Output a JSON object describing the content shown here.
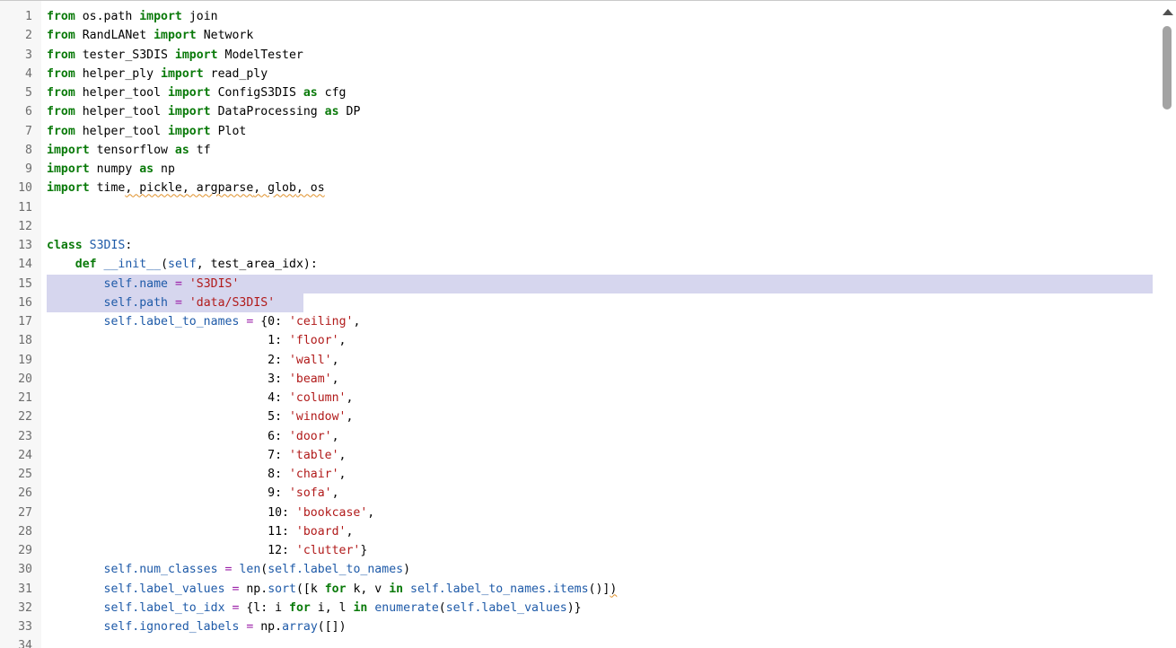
{
  "editor": {
    "highlighted_lines": [
      15,
      16
    ],
    "lines": [
      {
        "n": "1",
        "segs": [
          {
            "t": "from",
            "c": "kw"
          },
          {
            "t": " os.path "
          },
          {
            "t": "import",
            "c": "kw"
          },
          {
            "t": " join"
          }
        ]
      },
      {
        "n": "2",
        "segs": [
          {
            "t": "from",
            "c": "kw"
          },
          {
            "t": " RandLANet "
          },
          {
            "t": "import",
            "c": "kw"
          },
          {
            "t": " Network"
          }
        ]
      },
      {
        "n": "3",
        "segs": [
          {
            "t": "from",
            "c": "kw"
          },
          {
            "t": " tester_S3DIS "
          },
          {
            "t": "import",
            "c": "kw"
          },
          {
            "t": " ModelTester"
          }
        ]
      },
      {
        "n": "4",
        "segs": [
          {
            "t": "from",
            "c": "kw"
          },
          {
            "t": " helper_ply "
          },
          {
            "t": "import",
            "c": "kw"
          },
          {
            "t": " read_ply"
          }
        ]
      },
      {
        "n": "5",
        "segs": [
          {
            "t": "from",
            "c": "kw"
          },
          {
            "t": " helper_tool "
          },
          {
            "t": "import",
            "c": "kw"
          },
          {
            "t": " ConfigS3DIS "
          },
          {
            "t": "as",
            "c": "kw"
          },
          {
            "t": " cfg"
          }
        ]
      },
      {
        "n": "6",
        "segs": [
          {
            "t": "from",
            "c": "kw"
          },
          {
            "t": " helper_tool "
          },
          {
            "t": "import",
            "c": "kw"
          },
          {
            "t": " DataProcessing "
          },
          {
            "t": "as",
            "c": "kw"
          },
          {
            "t": " DP"
          }
        ]
      },
      {
        "n": "7",
        "segs": [
          {
            "t": "from",
            "c": "kw"
          },
          {
            "t": " helper_tool "
          },
          {
            "t": "import",
            "c": "kw"
          },
          {
            "t": " Plot"
          }
        ]
      },
      {
        "n": "8",
        "segs": [
          {
            "t": "import",
            "c": "kw"
          },
          {
            "t": " tensorflow "
          },
          {
            "t": "as",
            "c": "kw"
          },
          {
            "t": " tf"
          }
        ]
      },
      {
        "n": "9",
        "segs": [
          {
            "t": "import",
            "c": "kw"
          },
          {
            "t": " numpy "
          },
          {
            "t": "as",
            "c": "kw"
          },
          {
            "t": " np"
          }
        ]
      },
      {
        "n": "10",
        "segs": [
          {
            "t": "import",
            "c": "kw"
          },
          {
            "t": " time"
          },
          {
            "t": ", pickle",
            "c": "sq"
          },
          {
            "t": ", argparse",
            "c": "sq"
          },
          {
            "t": ", glob",
            "c": "sq"
          },
          {
            "t": ", os",
            "c": "sq"
          }
        ]
      },
      {
        "n": "11",
        "segs": []
      },
      {
        "n": "12",
        "segs": []
      },
      {
        "n": "13",
        "segs": [
          {
            "t": "class",
            "c": "kw"
          },
          {
            "t": " "
          },
          {
            "t": "S3DIS",
            "c": "cls"
          },
          {
            "t": ":"
          }
        ]
      },
      {
        "n": "14",
        "segs": [
          {
            "t": "    "
          },
          {
            "t": "def",
            "c": "kw"
          },
          {
            "t": " "
          },
          {
            "t": "__init__",
            "c": "cls"
          },
          {
            "t": "("
          },
          {
            "t": "self",
            "c": "attr"
          },
          {
            "t": ", test_area_idx):"
          }
        ]
      },
      {
        "n": "15",
        "segs": [
          {
            "t": "        "
          },
          {
            "t": "self.name",
            "c": "attr"
          },
          {
            "t": " "
          },
          {
            "t": "=",
            "c": "op"
          },
          {
            "t": " "
          },
          {
            "t": "'S3DIS'",
            "c": "str"
          }
        ]
      },
      {
        "n": "16",
        "segs": [
          {
            "t": "        "
          },
          {
            "t": "self.path",
            "c": "attr"
          },
          {
            "t": " "
          },
          {
            "t": "=",
            "c": "op"
          },
          {
            "t": " "
          },
          {
            "t": "'data/S3DIS'",
            "c": "str"
          }
        ]
      },
      {
        "n": "17",
        "segs": [
          {
            "t": "        "
          },
          {
            "t": "self.label_to_names",
            "c": "attr"
          },
          {
            "t": " "
          },
          {
            "t": "=",
            "c": "op"
          },
          {
            "t": " {0: "
          },
          {
            "t": "'ceiling'",
            "c": "str"
          },
          {
            "t": ","
          }
        ]
      },
      {
        "n": "18",
        "segs": [
          {
            "t": "                               1: "
          },
          {
            "t": "'floor'",
            "c": "str"
          },
          {
            "t": ","
          }
        ]
      },
      {
        "n": "19",
        "segs": [
          {
            "t": "                               2: "
          },
          {
            "t": "'wall'",
            "c": "str"
          },
          {
            "t": ","
          }
        ]
      },
      {
        "n": "20",
        "segs": [
          {
            "t": "                               3: "
          },
          {
            "t": "'beam'",
            "c": "str"
          },
          {
            "t": ","
          }
        ]
      },
      {
        "n": "21",
        "segs": [
          {
            "t": "                               4: "
          },
          {
            "t": "'column'",
            "c": "str"
          },
          {
            "t": ","
          }
        ]
      },
      {
        "n": "22",
        "segs": [
          {
            "t": "                               5: "
          },
          {
            "t": "'window'",
            "c": "str"
          },
          {
            "t": ","
          }
        ]
      },
      {
        "n": "23",
        "segs": [
          {
            "t": "                               6: "
          },
          {
            "t": "'door'",
            "c": "str"
          },
          {
            "t": ","
          }
        ]
      },
      {
        "n": "24",
        "segs": [
          {
            "t": "                               7: "
          },
          {
            "t": "'table'",
            "c": "str"
          },
          {
            "t": ","
          }
        ]
      },
      {
        "n": "25",
        "segs": [
          {
            "t": "                               8: "
          },
          {
            "t": "'chair'",
            "c": "str"
          },
          {
            "t": ","
          }
        ]
      },
      {
        "n": "26",
        "segs": [
          {
            "t": "                               9: "
          },
          {
            "t": "'sofa'",
            "c": "str"
          },
          {
            "t": ","
          }
        ]
      },
      {
        "n": "27",
        "segs": [
          {
            "t": "                               10: "
          },
          {
            "t": "'bookcase'",
            "c": "str"
          },
          {
            "t": ","
          }
        ]
      },
      {
        "n": "28",
        "segs": [
          {
            "t": "                               11: "
          },
          {
            "t": "'board'",
            "c": "str"
          },
          {
            "t": ","
          }
        ]
      },
      {
        "n": "29",
        "segs": [
          {
            "t": "                               12: "
          },
          {
            "t": "'clutter'",
            "c": "str"
          },
          {
            "t": "}"
          }
        ]
      },
      {
        "n": "30",
        "segs": [
          {
            "t": "        "
          },
          {
            "t": "self.num_classes",
            "c": "attr"
          },
          {
            "t": " "
          },
          {
            "t": "=",
            "c": "op"
          },
          {
            "t": " "
          },
          {
            "t": "len",
            "c": "attr"
          },
          {
            "t": "("
          },
          {
            "t": "self.label_to_names",
            "c": "attr"
          },
          {
            "t": ")"
          }
        ]
      },
      {
        "n": "31",
        "segs": [
          {
            "t": "        "
          },
          {
            "t": "self.label_values",
            "c": "attr"
          },
          {
            "t": " "
          },
          {
            "t": "=",
            "c": "op"
          },
          {
            "t": " np."
          },
          {
            "t": "sort",
            "c": "attr"
          },
          {
            "t": "([k "
          },
          {
            "t": "for",
            "c": "kw"
          },
          {
            "t": " k, v "
          },
          {
            "t": "in",
            "c": "kw"
          },
          {
            "t": " "
          },
          {
            "t": "self.label_to_names.items",
            "c": "attr"
          },
          {
            "t": "()]"
          },
          {
            "t": ")",
            "c": "sq"
          }
        ]
      },
      {
        "n": "32",
        "segs": [
          {
            "t": "        "
          },
          {
            "t": "self.label_to_idx",
            "c": "attr"
          },
          {
            "t": " "
          },
          {
            "t": "=",
            "c": "op"
          },
          {
            "t": " {l: i "
          },
          {
            "t": "for",
            "c": "kw"
          },
          {
            "t": " i, l "
          },
          {
            "t": "in",
            "c": "kw"
          },
          {
            "t": " "
          },
          {
            "t": "enumerate",
            "c": "attr"
          },
          {
            "t": "("
          },
          {
            "t": "self.label_values",
            "c": "attr"
          },
          {
            "t": ")}"
          }
        ]
      },
      {
        "n": "33",
        "segs": [
          {
            "t": "        "
          },
          {
            "t": "self.ignored_labels",
            "c": "attr"
          },
          {
            "t": " "
          },
          {
            "t": "=",
            "c": "op"
          },
          {
            "t": " np."
          },
          {
            "t": "array",
            "c": "attr"
          },
          {
            "t": "([])"
          }
        ]
      },
      {
        "n": "34",
        "segs": []
      }
    ]
  },
  "scrollbar": {
    "up_icon": "chevron-up-icon"
  }
}
